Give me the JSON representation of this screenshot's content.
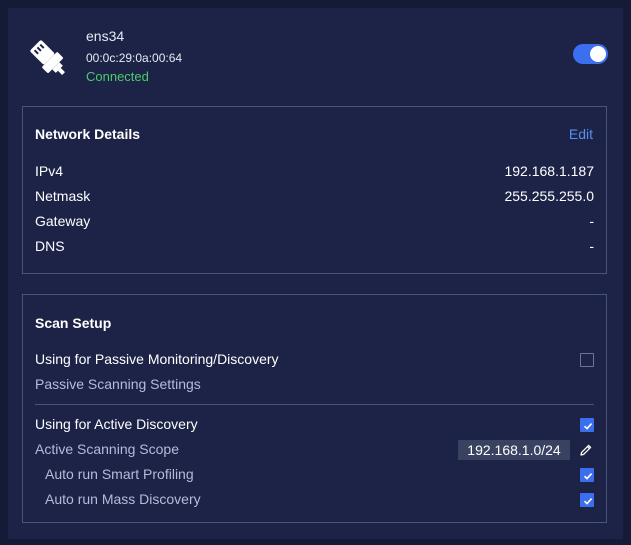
{
  "interface": {
    "name": "ens34",
    "mac": "00:0c:29:0a:00:64",
    "status": "Connected",
    "status_color": "#4ccc6a",
    "enabled": true,
    "icon": "ethernet-plug-icon"
  },
  "network_details": {
    "title": "Network Details",
    "edit_label": "Edit",
    "rows": [
      {
        "label": "IPv4",
        "value": "192.168.1.187"
      },
      {
        "label": "Netmask",
        "value": "255.255.255.0"
      },
      {
        "label": "Gateway",
        "value": "-"
      },
      {
        "label": "DNS",
        "value": "-"
      }
    ]
  },
  "scan_setup": {
    "title": "Scan Setup",
    "passive": {
      "label": "Using for Passive Monitoring/Discovery",
      "checked": false,
      "settings_label": "Passive Scanning Settings"
    },
    "active": {
      "label": "Using for Active Discovery",
      "checked": true,
      "scope_label": "Active Scanning Scope",
      "scope_value": "192.168.1.0/24",
      "smart_profiling_label": "Auto run Smart Profiling",
      "smart_profiling_checked": true,
      "mass_discovery_label": "Auto run Mass Discovery",
      "mass_discovery_checked": true
    }
  },
  "colors": {
    "background": "#151b36",
    "panel": "#1c2347",
    "accent": "#3b6ff0",
    "link": "#5b8df0",
    "border": "#4a5378"
  }
}
